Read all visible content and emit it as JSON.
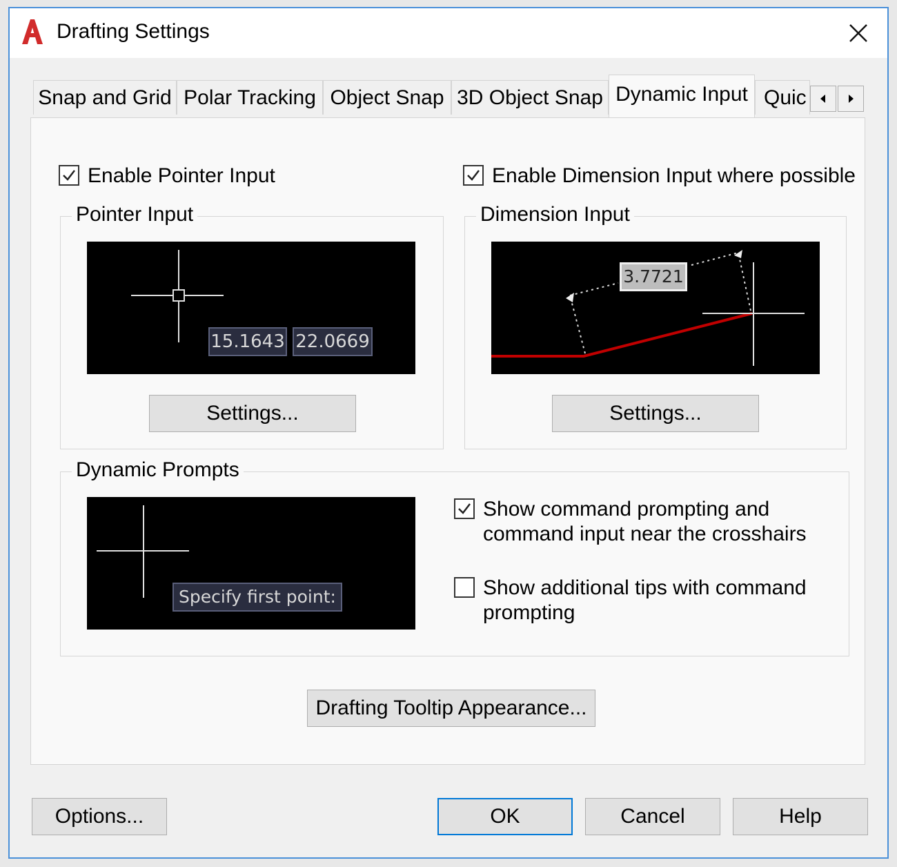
{
  "window": {
    "title": "Drafting Settings"
  },
  "tabs": [
    {
      "label": "Snap and Grid",
      "active": false
    },
    {
      "label": "Polar Tracking",
      "active": false
    },
    {
      "label": "Object Snap",
      "active": false
    },
    {
      "label": "3D Object Snap",
      "active": false
    },
    {
      "label": "Dynamic Input",
      "active": true
    },
    {
      "label": "Quic",
      "active": false
    }
  ],
  "dynamic_input": {
    "enable_pointer_input": {
      "label": "Enable Pointer Input",
      "checked": true
    },
    "enable_dimension_input": {
      "label": "Enable Dimension Input where possible",
      "checked": true
    },
    "pointer_input": {
      "title": "Pointer Input",
      "coord_x": "15.1643",
      "coord_y": "22.0669",
      "settings_label": "Settings..."
    },
    "dimension_input": {
      "title": "Dimension Input",
      "value": "3.7721",
      "settings_label": "Settings..."
    },
    "dynamic_prompts": {
      "title": "Dynamic Prompts",
      "prompt_text": "Specify first point:",
      "show_command_prompting": {
        "label": "Show command prompting and command input near the crosshairs",
        "checked": true
      },
      "show_additional_tips": {
        "label": "Show additional tips with command prompting",
        "checked": false
      }
    },
    "tooltip_appearance_label": "Drafting Tooltip Appearance..."
  },
  "footer": {
    "options_label": "Options...",
    "ok_label": "OK",
    "cancel_label": "Cancel",
    "help_label": "Help"
  },
  "colors": {
    "accent": "#0078d7",
    "dimension_line": "#c00000",
    "app_icon": "#d12b2b"
  },
  "icons": {
    "app": "autocad-a-icon",
    "close": "close-x-icon",
    "scroll_left": "triangle-left-icon",
    "scroll_right": "triangle-right-icon",
    "check": "checkmark-icon"
  }
}
